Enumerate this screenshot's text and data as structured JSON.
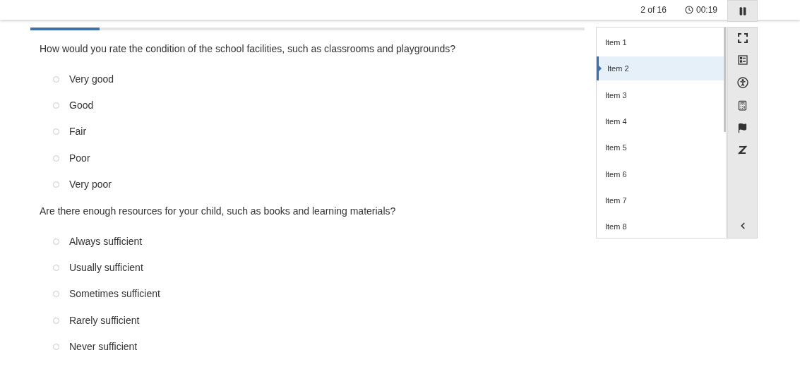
{
  "header": {
    "position": "2 of 16",
    "timer": "00:19"
  },
  "progress": {
    "level": 0.125
  },
  "questions": [
    {
      "text": "How would you rate the condition of the school facilities, such as classrooms and playgrounds?",
      "options": [
        {
          "label": "Very good",
          "selected": false
        },
        {
          "label": "Good",
          "selected": false
        },
        {
          "label": "Fair",
          "selected": false
        },
        {
          "label": "Poor",
          "selected": false
        },
        {
          "label": "Very poor",
          "selected": false
        }
      ]
    },
    {
      "text": "Are there enough resources for your child, such as books and learning materials?",
      "options": [
        {
          "label": "Always sufficient",
          "selected": false
        },
        {
          "label": "Usually sufficient",
          "selected": false
        },
        {
          "label": "Sometimes sufficient",
          "selected": false
        },
        {
          "label": "Rarely sufficient",
          "selected": false
        },
        {
          "label": "Never sufficient",
          "selected": false
        }
      ]
    }
  ],
  "items": [
    {
      "label": "Item 1",
      "selected": false
    },
    {
      "label": "Item 2",
      "selected": true
    },
    {
      "label": "Item 3",
      "selected": false
    },
    {
      "label": "Item 4",
      "selected": false
    },
    {
      "label": "Item 5",
      "selected": false
    },
    {
      "label": "Item 6",
      "selected": false
    },
    {
      "label": "Item 7",
      "selected": false
    },
    {
      "label": "Item 8",
      "selected": false
    }
  ]
}
